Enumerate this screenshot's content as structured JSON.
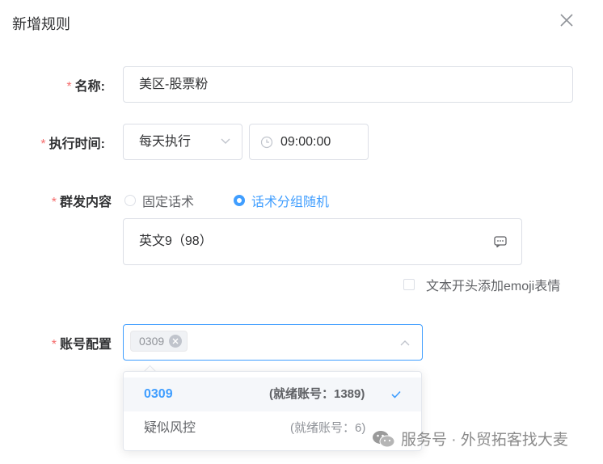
{
  "dialog": {
    "title": "新增规则"
  },
  "form": {
    "name": {
      "required_mark": "*",
      "label": "名称:",
      "value": "美区-股票粉"
    },
    "exec_time": {
      "required_mark": "*",
      "label": "执行时间:",
      "frequency": "每天执行",
      "time": "09:00:00"
    },
    "content": {
      "required_mark": "*",
      "label": "群发内容",
      "options": [
        {
          "label": "固定话术",
          "checked": false
        },
        {
          "label": "话术分组随机",
          "checked": true
        }
      ],
      "selected_group": "英文9（98）",
      "emoji_checkbox": {
        "label": "文本开头添加emoji表情",
        "checked": false
      }
    },
    "account": {
      "required_mark": "*",
      "label": "账号配置",
      "tags": [
        "0309"
      ],
      "dropdown": [
        {
          "name": "0309",
          "detail": "(就绪账号：1389)",
          "selected": true
        },
        {
          "name": "疑似风控",
          "detail": "(就绪账号：6)",
          "selected": false
        }
      ]
    }
  },
  "watermark": {
    "text": "服务号 · 外贸拓客找大麦"
  },
  "colors": {
    "primary": "#409eff",
    "required": "#f56c6c",
    "border": "#dcdfe6"
  }
}
